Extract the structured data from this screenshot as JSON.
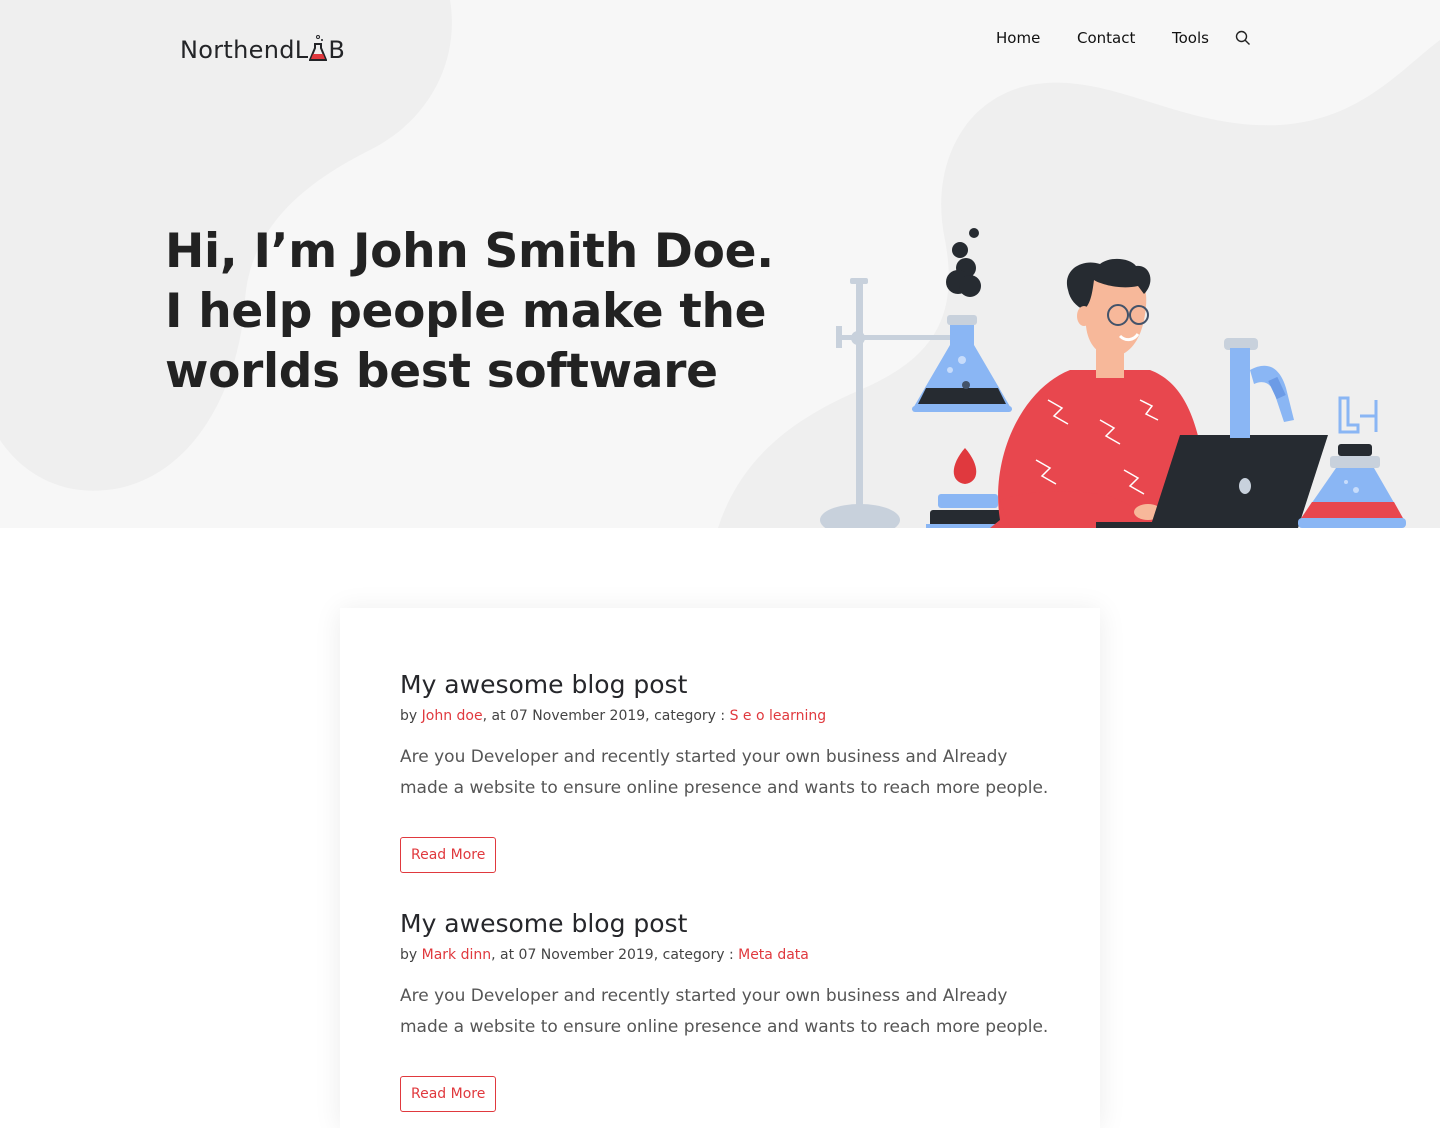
{
  "colors": {
    "accent": "#e0393e",
    "hero_bg": "#f7f7f7",
    "text_dark": "#222222",
    "laptop": "#262b31",
    "sweater": "#e8474e",
    "glass": "#8ab6f4"
  },
  "header": {
    "logo_text": "Northend",
    "logo_suffix_left": "L",
    "logo_suffix_right": "B",
    "nav": [
      {
        "label": "Home"
      },
      {
        "label": "Contact"
      },
      {
        "label": "Tools"
      }
    ],
    "search_icon": "search-icon"
  },
  "hero": {
    "title_lines": [
      "Hi, I’m John Smith Doe.",
      "I help people make the",
      "worlds best software"
    ],
    "illustration": "scientist-with-laptop-and-lab-flasks"
  },
  "posts": [
    {
      "title": "My awesome blog post",
      "by": "by ",
      "author": "John doe",
      "date_text": ", at 07 November 2019, category : ",
      "category": "S e o learning",
      "excerpt": "Are you Developer and recently started your own business and Already made a website to ensure online presence and wants to reach more people.",
      "read_more": "Read More"
    },
    {
      "title": "My awesome blog post",
      "by": "by ",
      "author": "Mark dinn",
      "date_text": ", at 07 November 2019, category : ",
      "category": "Meta data",
      "excerpt": "Are you Developer and recently started your own business and Already made a website to ensure online presence and wants to reach more people.",
      "read_more": "Read More"
    }
  ]
}
